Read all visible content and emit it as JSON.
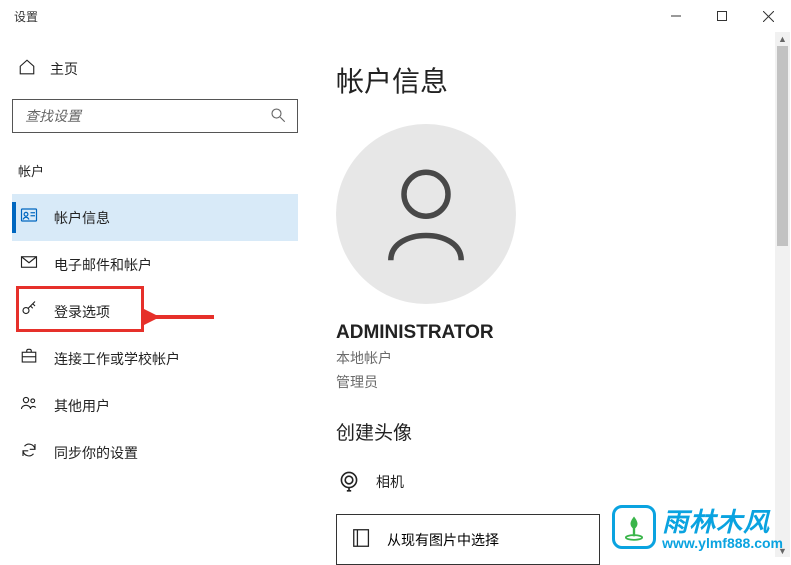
{
  "window": {
    "title": "设置"
  },
  "sidebar": {
    "home_label": "主页",
    "search_placeholder": "查找设置",
    "section_label": "帐户",
    "items": [
      {
        "label": "帐户信息",
        "icon": "user-card-icon",
        "active": true
      },
      {
        "label": "电子邮件和帐户",
        "icon": "mail-icon"
      },
      {
        "label": "登录选项",
        "icon": "key-icon",
        "highlighted": true
      },
      {
        "label": "连接工作或学校帐户",
        "icon": "briefcase-icon"
      },
      {
        "label": "其他用户",
        "icon": "people-icon"
      },
      {
        "label": "同步你的设置",
        "icon": "sync-icon"
      }
    ]
  },
  "content": {
    "page_title": "帐户信息",
    "username": "ADMINISTRATOR",
    "account_type": "本地帐户",
    "role": "管理员",
    "avatar_section_heading": "创建头像",
    "camera_option": "相机",
    "browse_option": "从现有图片中选择"
  },
  "watermark": {
    "brand": "雨林木风",
    "url": "www.ylmf888.com"
  }
}
